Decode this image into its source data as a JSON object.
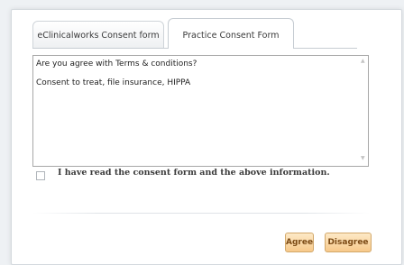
{
  "tabs": [
    {
      "label": "eClinicalworks Consent form",
      "active": false
    },
    {
      "label": "Practice Consent Form",
      "active": true
    }
  ],
  "consent": {
    "line1": "Are you agree with Terms & conditions?",
    "line2": "Consent to treat, file insurance, HIPPA"
  },
  "acknowledge": {
    "label": "I have read the consent form and the above information.",
    "checked": false
  },
  "buttons": {
    "agree": "Agree",
    "disagree": "Disagree"
  },
  "colors": {
    "button_bg": "#f7c98a",
    "button_text": "#7b4a14"
  }
}
